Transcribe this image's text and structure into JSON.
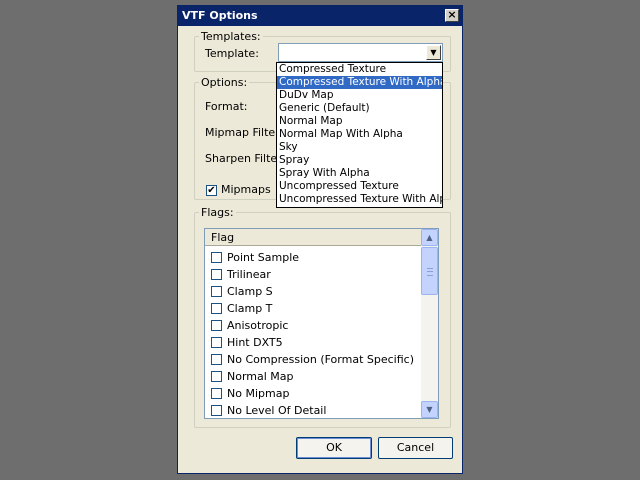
{
  "window": {
    "title": "VTF Options"
  },
  "templates": {
    "legend": "Templates:",
    "template_label": "Template:",
    "template_value": ""
  },
  "options": {
    "legend": "Options:",
    "format_label": "Format:",
    "mipmap_filter_label": "Mipmap Filter:",
    "sharpen_filter_label": "Sharpen Filter:",
    "mipmaps_label": "Mipmaps",
    "mipmaps_checked": true
  },
  "flags": {
    "legend": "Flags:",
    "column_header": "Flag",
    "items": [
      {
        "label": "Point Sample",
        "checked": false
      },
      {
        "label": "Trilinear",
        "checked": false
      },
      {
        "label": "Clamp S",
        "checked": false
      },
      {
        "label": "Clamp T",
        "checked": false
      },
      {
        "label": "Anisotropic",
        "checked": false
      },
      {
        "label": "Hint DXT5",
        "checked": false
      },
      {
        "label": "No Compression (Format Specific)",
        "checked": false
      },
      {
        "label": "Normal Map",
        "checked": false
      },
      {
        "label": "No Mipmap",
        "checked": false
      },
      {
        "label": "No Level Of Detail",
        "checked": false
      }
    ]
  },
  "buttons": {
    "ok_label": "OK",
    "cancel_label": "Cancel"
  },
  "dropdown": {
    "selected_index": 1,
    "items": [
      "Compressed Texture",
      "Compressed Texture With Alpha",
      "DuDv Map",
      "Generic (Default)",
      "Normal Map",
      "Normal Map With Alpha",
      "Sky",
      "Spray",
      "Spray With Alpha",
      "Uncompressed Texture",
      "Uncompressed Texture With Alpha"
    ]
  },
  "icons": {
    "close": "close-icon",
    "combo_arrow": "chevron-down-icon",
    "scroll_up": "chevron-up-icon",
    "scroll_down": "chevron-down-icon",
    "checkmark": "check-icon"
  },
  "colors": {
    "titlebar": "#0a246a",
    "dialog": "#ece9d8",
    "selection": "#316ac5",
    "backdrop": "#6e6e6e"
  }
}
